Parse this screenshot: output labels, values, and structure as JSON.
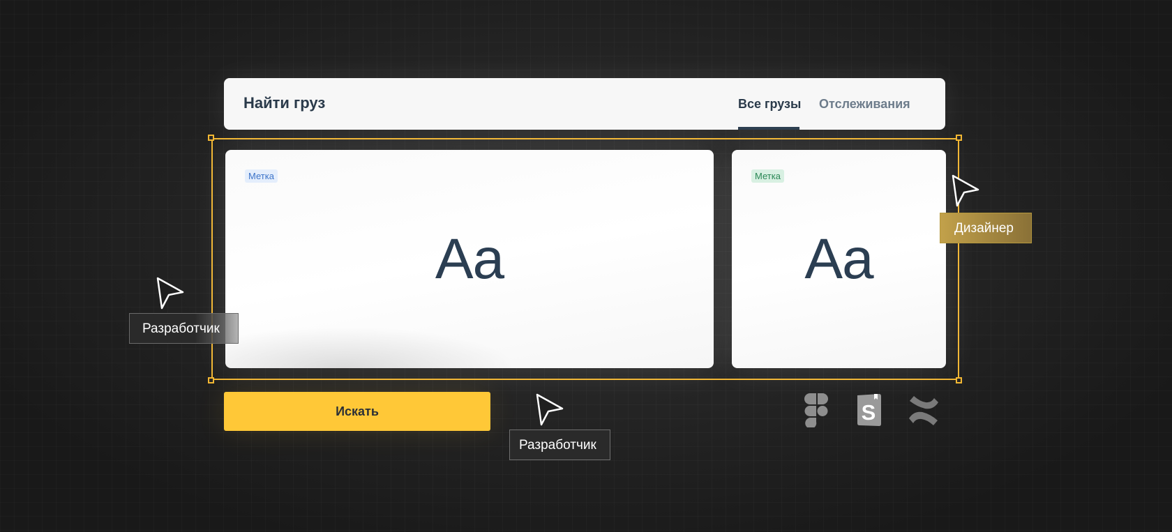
{
  "header": {
    "title": "Найти груз",
    "tabs": [
      {
        "label": "Все грузы",
        "active": true
      },
      {
        "label": "Отслеживания",
        "active": false
      }
    ]
  },
  "cards": [
    {
      "badge": "Метка",
      "badge_color": "#3d74c9",
      "sample": "Aa"
    },
    {
      "badge": "Метка",
      "badge_color": "#2a8755",
      "sample": "Aa"
    }
  ],
  "search_button": {
    "label": "Искать"
  },
  "cursors": [
    {
      "label": "Разработчик"
    },
    {
      "label": "Разработчик"
    },
    {
      "label": "Дизайнер"
    }
  ],
  "tools": [
    {
      "icon": "figma-icon"
    },
    {
      "icon": "storybook-icon"
    },
    {
      "icon": "confluence-icon"
    }
  ],
  "colors": {
    "accent": "#ffc837",
    "selection": "#f2b733",
    "text_dark": "#2a3a4a",
    "background": "#262626"
  }
}
